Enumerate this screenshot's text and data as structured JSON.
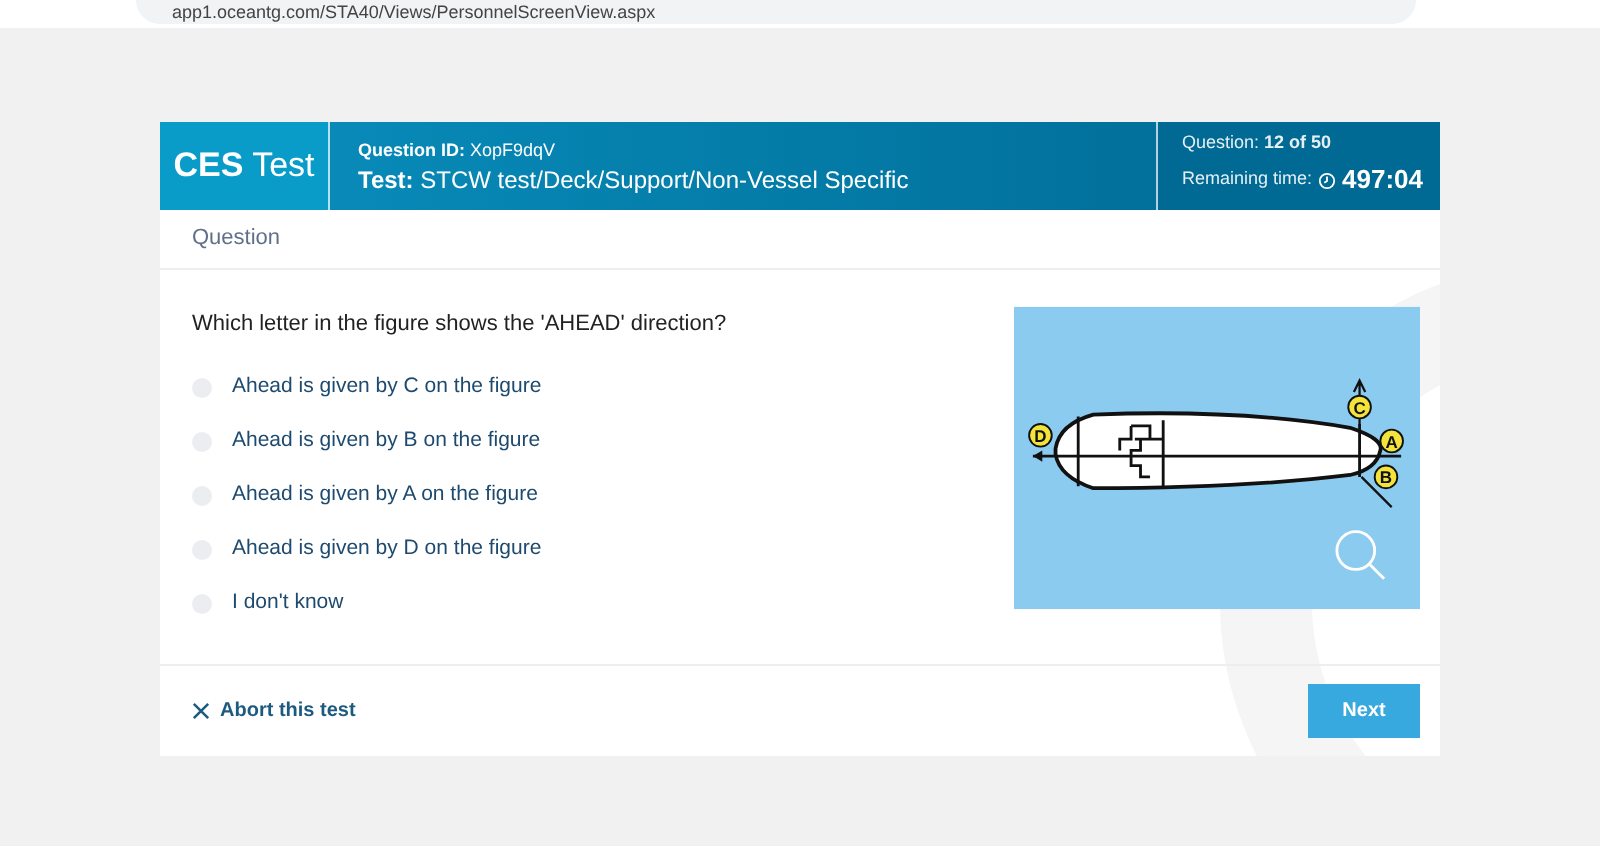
{
  "browser": {
    "url": "app1.oceantg.com/STA40/Views/PersonnelScreenView.aspx"
  },
  "header": {
    "brand_bold": "CES",
    "brand_rest": "Test",
    "question_id_label": "Question ID:",
    "question_id": "XopF9dqV",
    "test_label": "Test:",
    "test": "STCW test/Deck/Support/Non-Vessel Specific",
    "question_label": "Question:",
    "question_count": "12 of 50",
    "time_label": "Remaining time:",
    "time": "497:04"
  },
  "section_label": "Question",
  "question": "Which letter in the figure shows the 'AHEAD' direction?",
  "options": [
    {
      "label": "Ahead is given by C on the figure",
      "selected": false
    },
    {
      "label": "Ahead is given by B on the figure",
      "selected": false
    },
    {
      "label": "Ahead is given by A on the figure",
      "selected": false
    },
    {
      "label": "Ahead is given by D on the figure",
      "selected": false
    },
    {
      "label": "I don't know",
      "selected": false
    }
  ],
  "figure": {
    "labels": [
      "C",
      "A",
      "B",
      "D"
    ]
  },
  "footer": {
    "abort": "Abort this test",
    "next": "Next"
  }
}
